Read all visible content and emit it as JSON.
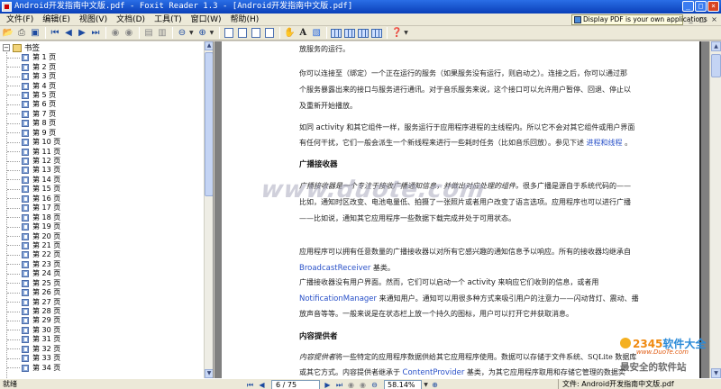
{
  "window": {
    "title": "Android开发指南中文版.pdf - Foxit Reader 1.3 - [Android开发指南中文版.pdf]",
    "controls": [
      "_",
      "□",
      "×"
    ]
  },
  "menu": [
    "文件(F)",
    "编辑(E)",
    "视图(V)",
    "文档(D)",
    "工具(T)",
    "窗口(W)",
    "帮助(H)"
  ],
  "promo_text": "Display PDF is your own applications",
  "mdi_controls": [
    "_",
    "□",
    "×"
  ],
  "toolbar_icons": [
    "open-icon",
    "print-icon",
    "save-icon",
    "first-page-icon",
    "prev-page-icon",
    "next-page-icon",
    "last-page-icon",
    "back-icon",
    "forward-icon",
    "rotate-left-icon",
    "rotate-right-icon",
    "zoom-out-icon",
    "zoom-in-icon",
    "actual-size-icon",
    "fit-page-icon",
    "fit-width-icon",
    "reflow-icon",
    "hand-tool-icon",
    "text-select-icon",
    "snapshot-icon",
    "single-page-icon",
    "continuous-icon",
    "facing-icon",
    "fullscreen-icon",
    "help-icon"
  ],
  "sidebar": {
    "root_label": "书签",
    "bookmarks": [
      "第 1 页",
      "第 2 页",
      "第 3 页",
      "第 4 页",
      "第 5 页",
      "第 6 页",
      "第 7 页",
      "第 8 页",
      "第 9 页",
      "第 10 页",
      "第 11 页",
      "第 12 页",
      "第 13 页",
      "第 14 页",
      "第 15 页",
      "第 16 页",
      "第 17 页",
      "第 18 页",
      "第 19 页",
      "第 20 页",
      "第 21 页",
      "第 22 页",
      "第 23 页",
      "第 24 页",
      "第 25 页",
      "第 26 页",
      "第 27 页",
      "第 28 页",
      "第 29 页",
      "第 30 页",
      "第 31 页",
      "第 32 页",
      "第 33 页",
      "第 34 页"
    ]
  },
  "document": {
    "p0": "放服务的运行。",
    "p1a": "你可以连接至（绑定）一个正在运行的服务（如果服务没有运行，则启动之）。连接之后，你可以通过那",
    "p1b": "个服务暴露出来的接口与服务进行通讯。对于音乐服务来说，这个接口可以允许用户暂停、回退、停止以",
    "p1c": "及重新开始播放。",
    "p2a_1": "如同 ",
    "p2a_2": "activity",
    "p2a_3": " 和其它组件一样，服务运行于应用程序进程的主线程内。所以它不会对其它组件或用户界面",
    "p2b_1": "有任何干扰，它们一般会派生一个新线程来进行一些耗时任务（比如音乐回放）。参见下述 ",
    "p2b_link": "进程和线程",
    "p2b_2": " 。",
    "h1": "广播接收器",
    "p3a_1": "广播接收器是",
    "p3a_2": "一个专注于接收广播通知信息，并做出对应处理的组件。",
    "p3a_3": "很多广播是源自于系统代码的——",
    "p3b": "比如，通知时区改变、电池电量低、拍摄了一张照片或者用户改变了语言选项。应用程序也可以进行广播",
    "p3c": "——比如说，通知其它应用程序一些数据下载完成并处于可用状态。",
    "p4a": "应用程序可以拥有任意数量的广播接收器以对所有它感兴趣的通知信息予以响应。所有的接收器均继承自",
    "p4b_link": "BroadcastReceiver",
    "p4b_2": " 基类。",
    "p5a_1": "广播接收器没有用户界面。然而，它们可以启动一个 ",
    "p5a_2": "activity",
    "p5a_3": " 来响应它们收到的信息，或者用",
    "p5b_link": "NotificationManager",
    "p5b_2": " 来通知用户。通知可以用很多种方式来吸引用户的注意力——闪动背灯、震动、播",
    "p5c": "放声音等等。一般来说是在状态栏上放一个持久的图标，用户可以打开它并获取消息。",
    "h2": "内容提供者",
    "p6a_1": "内容提供者",
    "p6a_2": "将一些特定的应用程序数据供给其它应用程序使用。数据可以存储于文件系统、SQLite 数据库",
    "p6b_1": "或其它方式。内容提供者继承于 ",
    "p6b_link": "ContentProvider",
    "p6b_2": " 基类，为其它应用程序取用和存储它管理的数据实",
    "watermark": "www.duote.com"
  },
  "corner_logo": {
    "line1_prefix": "2345",
    "line1_suffix": "软件大全",
    "line2": "www.DuoTe.com",
    "line3": "最安全的软件站"
  },
  "status": {
    "ready": "就绪",
    "page": "6 / 75",
    "zoom": "58.14%",
    "file": "文件: Android开发指南中文版.pdf"
  }
}
